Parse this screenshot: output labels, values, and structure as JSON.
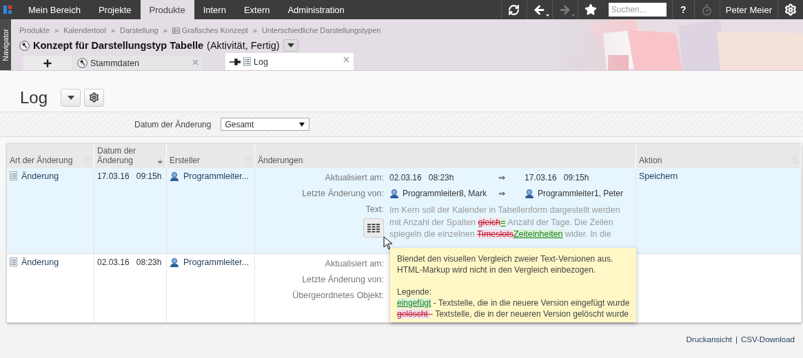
{
  "nav": {
    "tabs": [
      {
        "label": "Mein Bereich",
        "selected": false
      },
      {
        "label": "Projekte",
        "selected": false
      },
      {
        "label": "Produkte",
        "selected": true
      },
      {
        "label": "Intern",
        "selected": false
      },
      {
        "label": "Extern",
        "selected": false
      },
      {
        "label": "Administration",
        "selected": false
      }
    ],
    "tools": [
      {
        "kind": "refresh",
        "disabled": false
      },
      {
        "kind": "back",
        "disabled": false
      },
      {
        "kind": "forward",
        "disabled": true
      },
      {
        "kind": "star",
        "disabled": false
      }
    ],
    "search": {
      "placeholder": "Suchen..."
    },
    "help": "?",
    "timer": {
      "disabled": true
    },
    "user": "Peter Meier"
  },
  "navigator": "Navigator",
  "breadcrumb": {
    "separator": "»",
    "items": [
      {
        "label": "Produkte",
        "has_icon": false
      },
      {
        "label": "Kalendertool",
        "has_icon": false
      },
      {
        "label": "Darstellung",
        "has_icon": false
      },
      {
        "label": "Grafisches Konzept",
        "has_icon": true
      },
      {
        "label": "Unterschiedliche Darstellungstypen",
        "has_icon": false
      }
    ]
  },
  "title": {
    "main": "Konzept für Darstellungstyp Tabelle",
    "status": "(Aktivität, Fertig)"
  },
  "tabs": [
    {
      "label": "Stammdaten",
      "kind": "hammer",
      "selected": false
    },
    {
      "label": "Log",
      "kind": "list",
      "selected": true
    }
  ],
  "page": {
    "title": "Log"
  },
  "filter": {
    "label": "Datum der Änderung",
    "value": "Gesamt"
  },
  "table": {
    "columns": [
      {
        "label": "Art der Änderung",
        "sortable": true,
        "sorted": false
      },
      {
        "label": "Datum der Änderung",
        "sortable": true,
        "sorted": true
      },
      {
        "label": "Ersteller",
        "sortable": true,
        "sorted": false
      },
      {
        "label": "Änderungen",
        "sortable": false
      },
      {
        "label": "Aktion",
        "sortable": true,
        "sorted": false
      }
    ],
    "rows": [
      {
        "selected": true,
        "type": "Änderung",
        "date": "17.03.16",
        "time": "09:15h",
        "creator": "Programmleiter...",
        "action": "Speichern",
        "changes": [
          {
            "kind": "value",
            "label": "Aktualisiert am:",
            "old": {
              "date": "02.03.16",
              "time": "08:23h"
            },
            "arrow": "⇒",
            "new": {
              "date": "17.03.16",
              "time": "09:15h"
            }
          },
          {
            "kind": "person",
            "label": "Letzte Änderung von:",
            "old": {
              "name": "Programmleiter8, Mark"
            },
            "arrow": "⇒",
            "new": {
              "name": "Programmleiter1, Peter"
            }
          },
          {
            "kind": "text",
            "label": "Text:",
            "segments": [
              {
                "kind": "plain",
                "text": "Im Kern soll der Kalender in Tabellenform dargestellt werden mit Anzahl der Spalten "
              },
              {
                "kind": "deleted",
                "text": "gleich"
              },
              {
                "kind": "inserted",
                "text": "="
              },
              {
                "kind": "plain",
                "text": " Anzahl der Tage. Die Zeilen spiegeln die einzelnen "
              },
              {
                "kind": "deleted",
                "text": "Timeslots"
              },
              {
                "kind": "inserted",
                "text": "Zeiteinheiten"
              },
              {
                "kind": "plain",
                "text": " wider. In die"
              }
            ]
          }
        ]
      },
      {
        "selected": false,
        "type": "Änderung",
        "date": "02.03.16",
        "time": "08:23h",
        "creator": "Programmleiter...",
        "changes": [
          {
            "kind": "label",
            "label": "Aktualisiert am:"
          },
          {
            "kind": "label",
            "label": "Letzte Änderung von:"
          },
          {
            "kind": "label",
            "label": "Übergeordnetes Objekt:"
          }
        ]
      }
    ]
  },
  "tooltip": {
    "lines": [
      "Blendet den visuellen Vergleich zweier Text-Versionen aus.",
      "HTML-Markup wird nicht in den Vergleich einbezogen."
    ],
    "legend_title": "Legende:",
    "legend": [
      {
        "kind": "inserted",
        "sample": "eingefügt",
        "text": " - Textstelle, die in die neuere Version eingefügt wurde"
      },
      {
        "kind": "deleted",
        "sample": "gelöscht ",
        "text": "- Textstelle, die in der neueren Version gelöscht wurde"
      }
    ]
  },
  "footer": {
    "links": [
      "Druckansicht",
      "CSV-Download"
    ],
    "separator": "|"
  }
}
